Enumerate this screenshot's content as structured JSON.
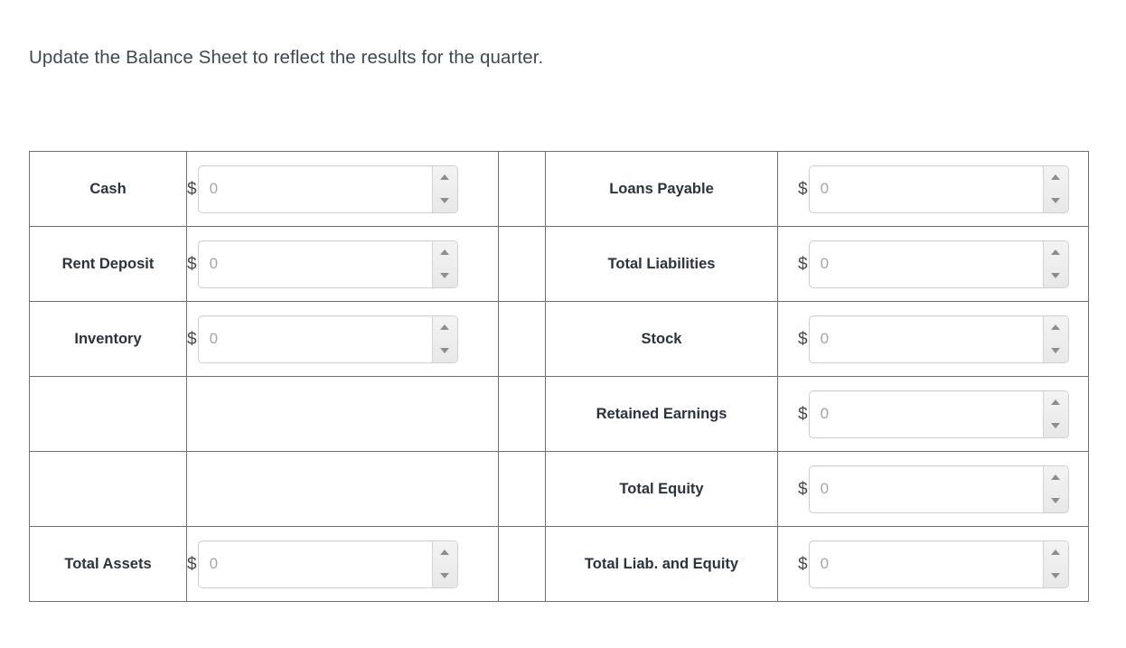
{
  "instruction": "Update the Balance Sheet to reflect the results for the quarter.",
  "currency_symbol": "$",
  "field_placeholder": "0",
  "spinner": {
    "increment_icon": "triangle-up-icon",
    "decrement_icon": "triangle-down-icon"
  },
  "balance_sheet": {
    "rows": [
      {
        "asset_label": "Cash",
        "asset_value": "",
        "asset_has_input": true,
        "liability_label": "Loans Payable",
        "liability_value": "",
        "liability_has_input": true
      },
      {
        "asset_label": "Rent Deposit",
        "asset_value": "",
        "asset_has_input": true,
        "liability_label": "Total Liabilities",
        "liability_value": "",
        "liability_has_input": true
      },
      {
        "asset_label": "Inventory",
        "asset_value": "",
        "asset_has_input": true,
        "liability_label": "Stock",
        "liability_value": "",
        "liability_has_input": true
      },
      {
        "asset_label": "",
        "asset_value": "",
        "asset_has_input": false,
        "liability_label": "Retained Earnings",
        "liability_value": "",
        "liability_has_input": true
      },
      {
        "asset_label": "",
        "asset_value": "",
        "asset_has_input": false,
        "liability_label": "Total Equity",
        "liability_value": "",
        "liability_has_input": true
      },
      {
        "asset_label": "Total Assets",
        "asset_value": "",
        "asset_has_input": true,
        "liability_label": "Total Liab. and Equity",
        "liability_value": "",
        "liability_has_input": true
      }
    ]
  },
  "colors": {
    "text": "#2b333d",
    "prompt_text": "#3d4852",
    "table_border": "#707070",
    "input_border": "#cfcfcf",
    "placeholder": "#a6a6a6",
    "spinner_arrow": "#8d8d8d"
  }
}
